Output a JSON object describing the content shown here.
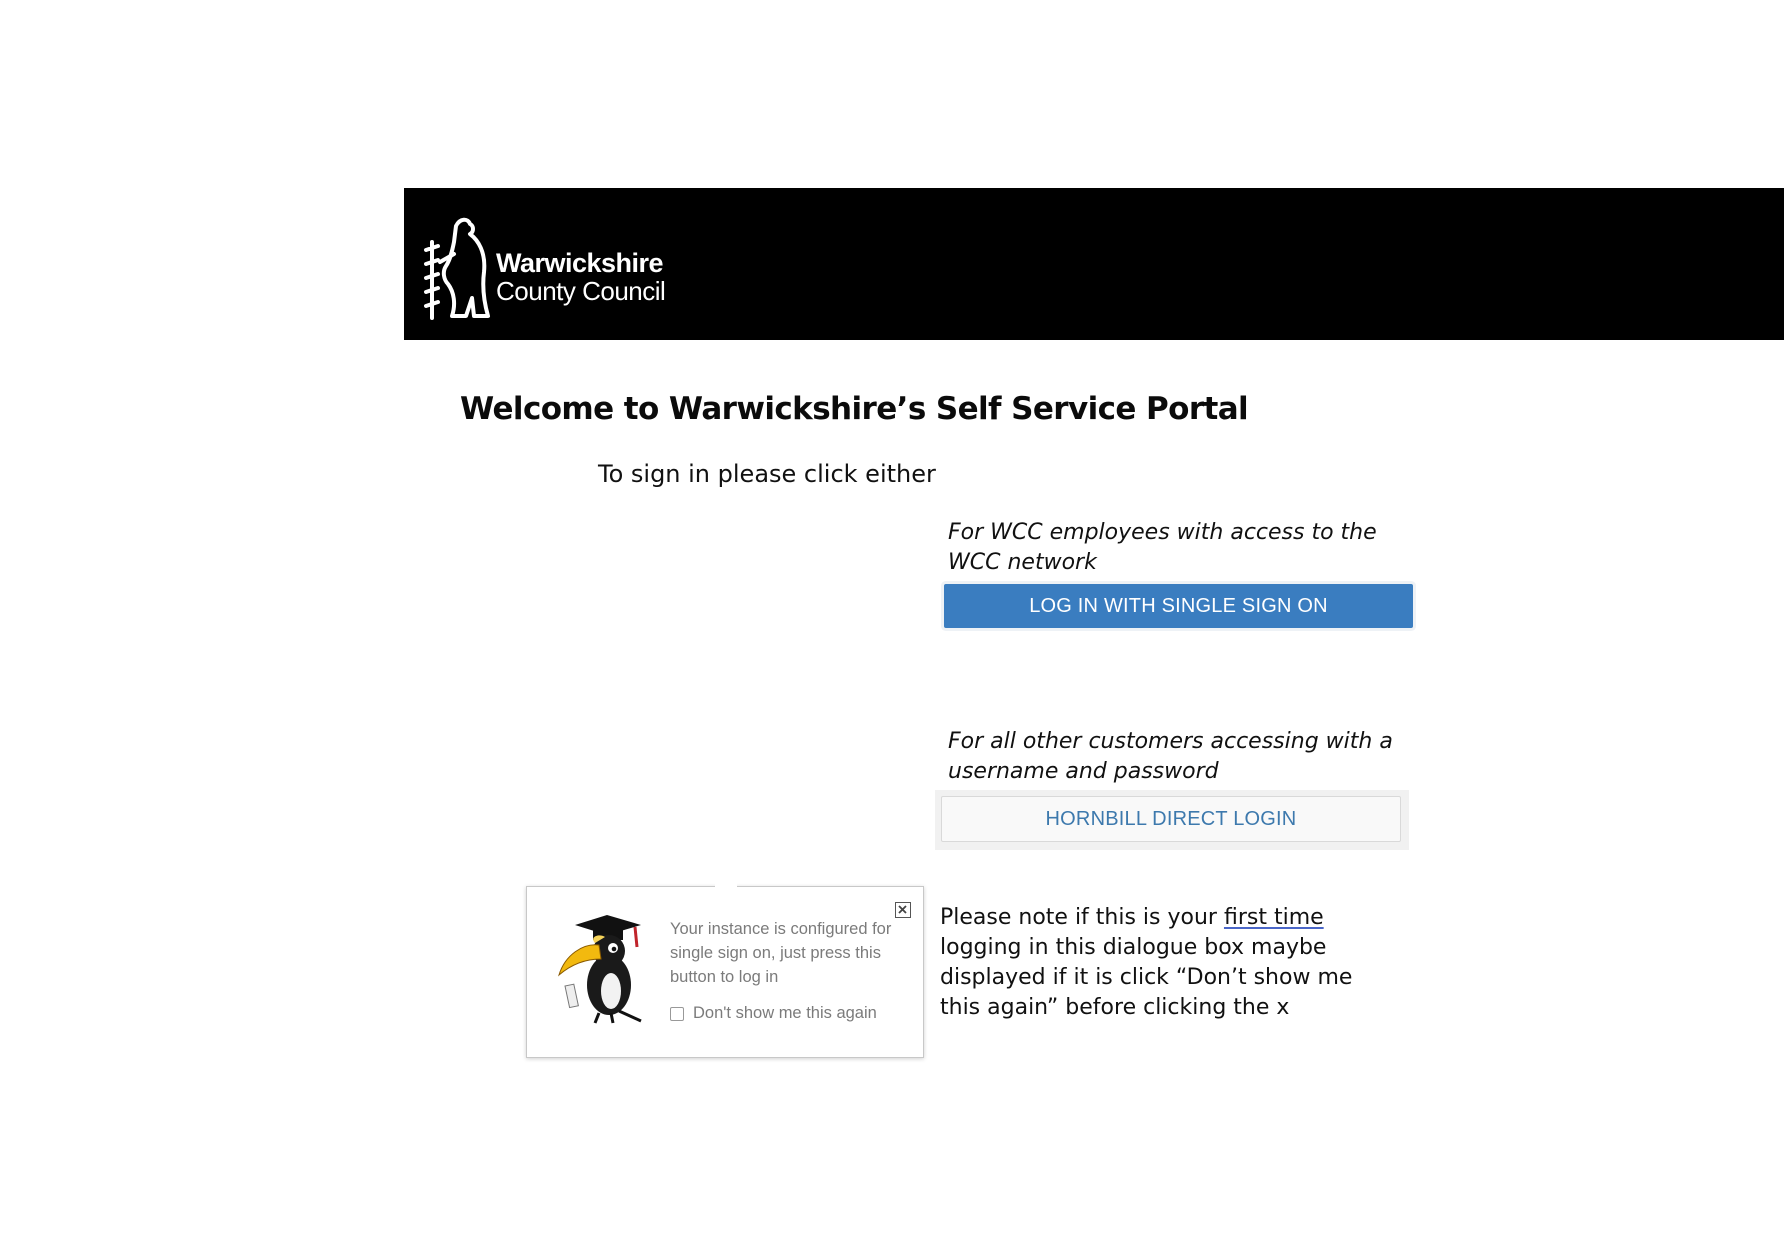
{
  "header": {
    "logo_line1": "Warwickshire",
    "logo_line2": "County Council",
    "logo_icon": "bear-and-ragged-staff-icon"
  },
  "main": {
    "welcome_title": "Welcome to Warwickshire’s Self Service Portal",
    "intro": "To sign in please click either",
    "wcc_note": "For WCC employees with access to the WCC network",
    "sso_button_label": "LOG IN WITH SINGLE SIGN ON",
    "other_note": "For all other customers accessing with a username and password",
    "direct_button_label": "HORNBILL DIRECT LOGIN"
  },
  "popup": {
    "message": "Your instance is configured for single sign on, just press this button to log in",
    "checkbox_label": "Don't show me this again",
    "checkbox_checked": false,
    "mascot_icon": "hornbill-graduate-icon",
    "close_icon": "close-icon"
  },
  "side_note": {
    "part1": "Please note if this is your ",
    "highlight": "first time",
    "part2": " logging in this dialogue box maybe displayed if it is click “Don’t show me this again” before clicking the x"
  },
  "colors": {
    "header_bg": "#000000",
    "sso_button_bg": "#3a7dc0",
    "direct_button_text": "#3d79ad",
    "popup_text": "#7b7b7b"
  }
}
